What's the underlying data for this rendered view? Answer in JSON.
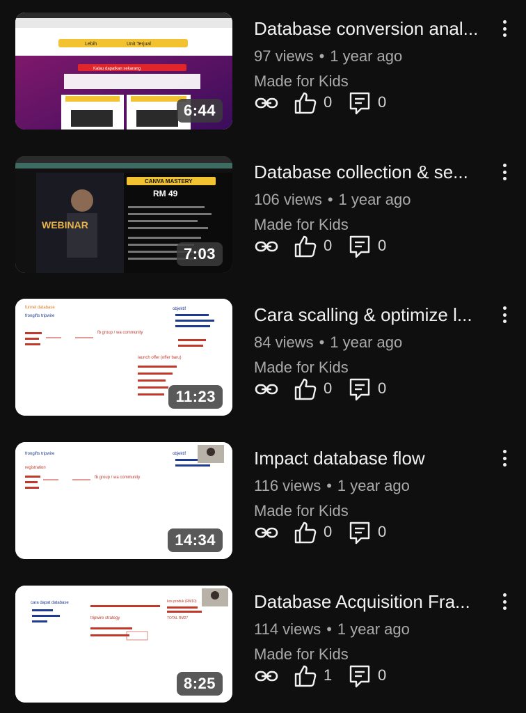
{
  "colors": {
    "background": "#0f0f0f",
    "title": "#f1f1f1",
    "secondary": "#aaaaaa",
    "duration_bg": "#3c3c3c"
  },
  "videos": [
    {
      "title": "Database conversion anal...",
      "views": "97 views",
      "age": "1 year ago",
      "audience": "Made for Kids",
      "duration": "6:44",
      "likes": "0",
      "comments": "0",
      "thumb_text": {
        "left_label": "Lebih",
        "right_label": "Unit Terjual",
        "banner": "Kalau dapatkan sekarang",
        "bonus1": "BONUS 1: PANDUAN IG ADS",
        "bonus2": "BONUS 2: TIKTOK ADS"
      }
    },
    {
      "title": "Database collection & se...",
      "views": "106 views",
      "age": "1 year ago",
      "audience": "Made for Kids",
      "duration": "7:03",
      "likes": "0",
      "comments": "0",
      "thumb_text": {
        "heading": "CANVA MASTERY",
        "price": "RM 49",
        "side": "WEBINAR"
      }
    },
    {
      "title": "Cara scalling & optimize l...",
      "views": "84 views",
      "age": "1 year ago",
      "audience": "Made for Kids",
      "duration": "11:23",
      "likes": "0",
      "comments": "0",
      "thumb_text": {
        "a": "funnel database",
        "b": "frongifts tripwire",
        "c": "objektif",
        "d": "launch offer (offer baru)",
        "e": "fb group / wa community"
      }
    },
    {
      "title": "Impact database flow",
      "views": "116 views",
      "age": "1 year ago",
      "audience": "Made for Kids",
      "duration": "14:34",
      "likes": "0",
      "comments": "0",
      "thumb_text": {
        "a": "frongifts tripwire",
        "b": "registration",
        "c": "fb group / wa community",
        "d": "objektif"
      }
    },
    {
      "title": "Database Acquisition Fra...",
      "views": "114 views",
      "age": "1 year ago",
      "audience": "Made for Kids",
      "duration": "8:25",
      "likes": "1",
      "comments": "0",
      "thumb_text": {
        "a": "cara dapat database",
        "b": "tripwire strategy",
        "c": "TOTAL RM27",
        "d": "kos produk (RM10)"
      }
    }
  ]
}
